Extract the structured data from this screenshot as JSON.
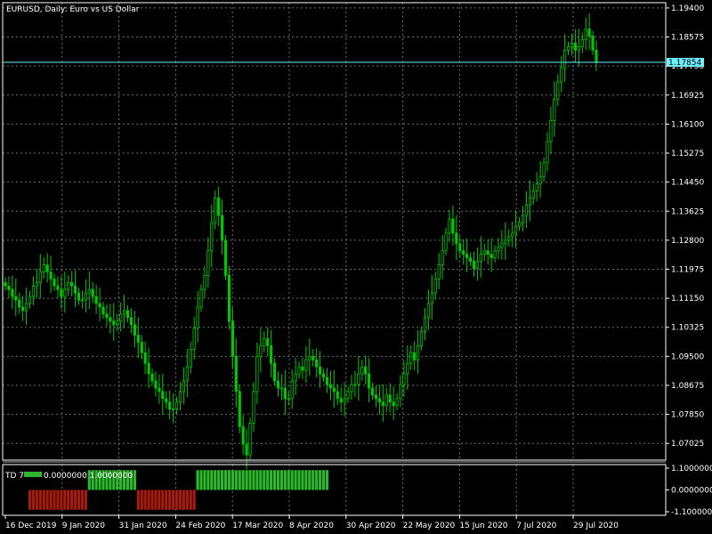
{
  "chart": {
    "title": "EURUSD, Daily:  Euro vs US Dollar",
    "current_price_label": "1.17854",
    "colors": {
      "background": "#000000",
      "grid": "#6e6e6e",
      "axis_text": "#ffffff",
      "bull_candle": "#00c800",
      "bear_candle": "#00c800",
      "price_line": "#6ff2ff",
      "indicator_up": "#2bb82b",
      "indicator_down": "#a41b10"
    }
  },
  "indicator": {
    "name": "TD 7",
    "values_text": "0.0000000 1.0000000",
    "ticks": [
      "1.1000000",
      "0.0000000",
      "-1.1000000"
    ]
  },
  "chart_data": [
    {
      "type": "candlestick",
      "x_ticks": [
        "16 Dec 2019",
        "9 Jan 2020",
        "31 Jan 2020",
        "24 Feb 2020",
        "17 Mar 2020",
        "8 Apr 2020",
        "30 Apr 2020",
        "22 May 2020",
        "15 Jun 2020",
        "7 Jul 2020",
        "29 Jul 2020"
      ],
      "y_ticks": [
        1.194,
        1.18575,
        1.1775,
        1.16925,
        1.161,
        1.15275,
        1.1445,
        1.13625,
        1.128,
        1.11975,
        1.1115,
        1.10325,
        1.095,
        1.08675,
        1.0785,
        1.07025
      ],
      "ylim": [
        1.0655,
        1.1955
      ],
      "last_price": 1.17854,
      "close_series": [
        1.115,
        1.114,
        1.112,
        1.111,
        1.109,
        1.108,
        1.11,
        1.112,
        1.115,
        1.116,
        1.119,
        1.121,
        1.119,
        1.117,
        1.115,
        1.114,
        1.112,
        1.114,
        1.116,
        1.115,
        1.113,
        1.111,
        1.111,
        1.113,
        1.114,
        1.112,
        1.11,
        1.109,
        1.107,
        1.106,
        1.105,
        1.104,
        1.105,
        1.107,
        1.108,
        1.106,
        1.104,
        1.101,
        1.099,
        1.096,
        1.093,
        1.09,
        1.088,
        1.086,
        1.085,
        1.083,
        1.082,
        1.08,
        1.08,
        1.082,
        1.085,
        1.088,
        1.092,
        1.097,
        1.103,
        1.109,
        1.114,
        1.118,
        1.125,
        1.133,
        1.14,
        1.135,
        1.128,
        1.118,
        1.105,
        1.095,
        1.085,
        1.075,
        1.07,
        1.067,
        1.076,
        1.085,
        1.095,
        1.098,
        1.1,
        1.098,
        1.093,
        1.088,
        1.086,
        1.086,
        1.083,
        1.083,
        1.088,
        1.09,
        1.092,
        1.091,
        1.094,
        1.095,
        1.094,
        1.092,
        1.09,
        1.089,
        1.087,
        1.086,
        1.085,
        1.083,
        1.082,
        1.083,
        1.085,
        1.087,
        1.087,
        1.09,
        1.092,
        1.09,
        1.086,
        1.084,
        1.083,
        1.082,
        1.081,
        1.084,
        1.082,
        1.081,
        1.083,
        1.087,
        1.09,
        1.093,
        1.096,
        1.094,
        1.098,
        1.102,
        1.106,
        1.11,
        1.113,
        1.117,
        1.121,
        1.125,
        1.13,
        1.134,
        1.13,
        1.127,
        1.125,
        1.124,
        1.123,
        1.122,
        1.12,
        1.122,
        1.124,
        1.125,
        1.124,
        1.123,
        1.125,
        1.126,
        1.127,
        1.128,
        1.129,
        1.13,
        1.132,
        1.133,
        1.135,
        1.138,
        1.14,
        1.142,
        1.144,
        1.146,
        1.15,
        1.156,
        1.162,
        1.168,
        1.173,
        1.177,
        1.182,
        1.183,
        1.184,
        1.182,
        1.183,
        1.185,
        1.188,
        1.186,
        1.182,
        1.1785
      ]
    },
    {
      "type": "bar",
      "ylim": [
        -1.1,
        1.1
      ],
      "segments": [
        {
          "value": 0,
          "count": 7
        },
        {
          "value": -1,
          "count": 17
        },
        {
          "value": 1,
          "count": 14
        },
        {
          "value": -1,
          "count": 17
        },
        {
          "value": 1,
          "count": 38
        }
      ]
    }
  ]
}
